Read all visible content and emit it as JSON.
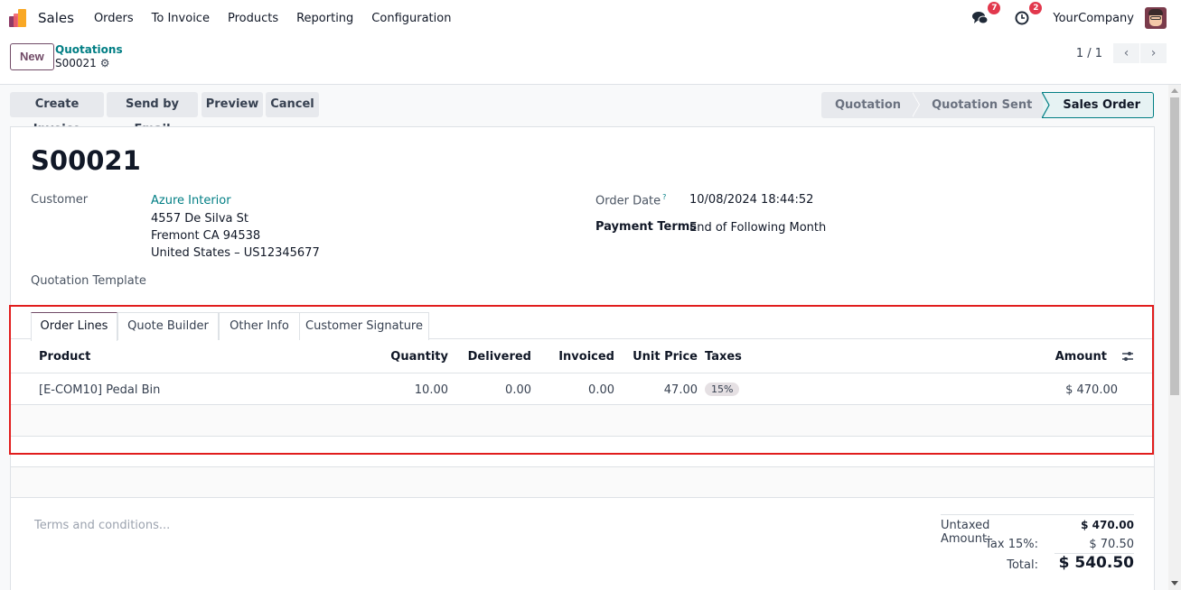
{
  "topnav": {
    "app_name": "Sales",
    "menu": [
      "Orders",
      "To Invoice",
      "Products",
      "Reporting",
      "Configuration"
    ],
    "messages_badge": "7",
    "activities_badge": "2",
    "company": "YourCompany",
    "icons": {
      "messages": "chat-bubbles-icon",
      "activities": "clock-icon"
    }
  },
  "control": {
    "new_label": "New",
    "breadcrumb_parent": "Quotations",
    "breadcrumb_current": "S00021",
    "pager_value": "1 / 1",
    "prev_glyph": "‹",
    "next_glyph": "›"
  },
  "statusbar": {
    "actions": [
      "Create Invoice",
      "Send by Email",
      "Preview",
      "Cancel"
    ],
    "stages": [
      "Quotation",
      "Quotation Sent",
      "Sales Order"
    ],
    "active_stage": "Sales Order"
  },
  "record": {
    "name": "S00021",
    "customer_label": "Customer",
    "customer_name": "Azure Interior",
    "customer_address": [
      "4557 De Silva St",
      "Fremont CA 94538",
      "United States – US12345677"
    ],
    "template_label": "Quotation Template",
    "order_date_label": "Order Date",
    "order_date_help": "?",
    "order_date": "10/08/2024 18:44:52",
    "payment_terms_label": "Payment Terms",
    "payment_terms": "End of Following Month"
  },
  "notebook": {
    "tabs": [
      "Order Lines",
      "Quote Builder",
      "Other Info",
      "Customer Signature"
    ],
    "active_tab": "Order Lines",
    "columns": [
      "Product",
      "Quantity",
      "Delivered",
      "Invoiced",
      "Unit Price",
      "Taxes",
      "Amount"
    ],
    "lines": [
      {
        "product": "[E-COM10] Pedal Bin",
        "quantity": "10.00",
        "delivered": "0.00",
        "invoiced": "0.00",
        "unit_price": "47.00",
        "taxes": "15%",
        "amount": "$ 470.00"
      }
    ]
  },
  "footer": {
    "terms_placeholder": "Terms and conditions...",
    "untaxed_label": "Untaxed Amount:",
    "untaxed_value": "$ 470.00",
    "tax_label": "Tax 15%:",
    "tax_value": "$ 70.50",
    "total_label": "Total:",
    "total_value": "$ 540.50"
  },
  "colors": {
    "brand": "#714b67",
    "link": "#017e84",
    "badge": "#e2384d",
    "highlight": "#e11d1d"
  }
}
